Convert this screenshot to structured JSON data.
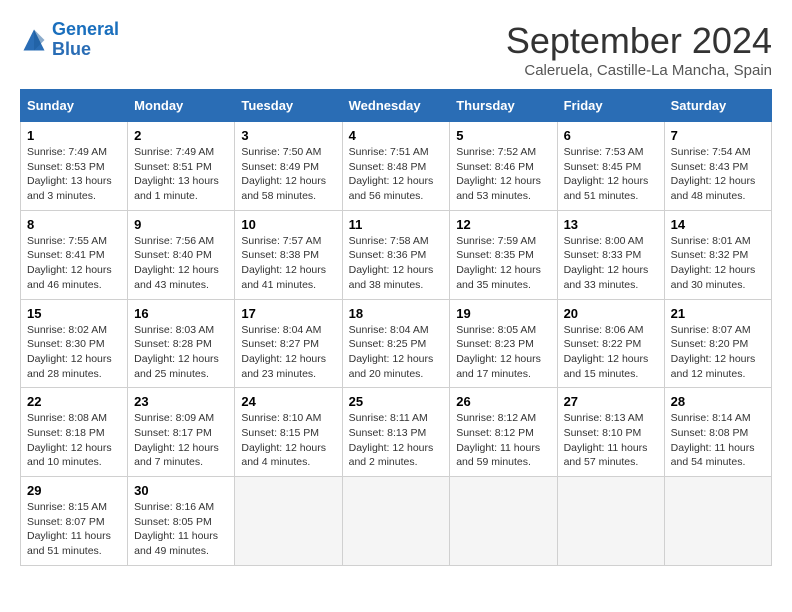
{
  "header": {
    "logo_line1": "General",
    "logo_line2": "Blue",
    "month_title": "September 2024",
    "location": "Caleruela, Castille-La Mancha, Spain"
  },
  "weekdays": [
    "Sunday",
    "Monday",
    "Tuesday",
    "Wednesday",
    "Thursday",
    "Friday",
    "Saturday"
  ],
  "weeks": [
    [
      {
        "day": "1",
        "sunrise": "7:49 AM",
        "sunset": "8:53 PM",
        "daylight": "13 hours and 3 minutes."
      },
      {
        "day": "2",
        "sunrise": "7:49 AM",
        "sunset": "8:51 PM",
        "daylight": "13 hours and 1 minute."
      },
      {
        "day": "3",
        "sunrise": "7:50 AM",
        "sunset": "8:49 PM",
        "daylight": "12 hours and 58 minutes."
      },
      {
        "day": "4",
        "sunrise": "7:51 AM",
        "sunset": "8:48 PM",
        "daylight": "12 hours and 56 minutes."
      },
      {
        "day": "5",
        "sunrise": "7:52 AM",
        "sunset": "8:46 PM",
        "daylight": "12 hours and 53 minutes."
      },
      {
        "day": "6",
        "sunrise": "7:53 AM",
        "sunset": "8:45 PM",
        "daylight": "12 hours and 51 minutes."
      },
      {
        "day": "7",
        "sunrise": "7:54 AM",
        "sunset": "8:43 PM",
        "daylight": "12 hours and 48 minutes."
      }
    ],
    [
      {
        "day": "8",
        "sunrise": "7:55 AM",
        "sunset": "8:41 PM",
        "daylight": "12 hours and 46 minutes."
      },
      {
        "day": "9",
        "sunrise": "7:56 AM",
        "sunset": "8:40 PM",
        "daylight": "12 hours and 43 minutes."
      },
      {
        "day": "10",
        "sunrise": "7:57 AM",
        "sunset": "8:38 PM",
        "daylight": "12 hours and 41 minutes."
      },
      {
        "day": "11",
        "sunrise": "7:58 AM",
        "sunset": "8:36 PM",
        "daylight": "12 hours and 38 minutes."
      },
      {
        "day": "12",
        "sunrise": "7:59 AM",
        "sunset": "8:35 PM",
        "daylight": "12 hours and 35 minutes."
      },
      {
        "day": "13",
        "sunrise": "8:00 AM",
        "sunset": "8:33 PM",
        "daylight": "12 hours and 33 minutes."
      },
      {
        "day": "14",
        "sunrise": "8:01 AM",
        "sunset": "8:32 PM",
        "daylight": "12 hours and 30 minutes."
      }
    ],
    [
      {
        "day": "15",
        "sunrise": "8:02 AM",
        "sunset": "8:30 PM",
        "daylight": "12 hours and 28 minutes."
      },
      {
        "day": "16",
        "sunrise": "8:03 AM",
        "sunset": "8:28 PM",
        "daylight": "12 hours and 25 minutes."
      },
      {
        "day": "17",
        "sunrise": "8:04 AM",
        "sunset": "8:27 PM",
        "daylight": "12 hours and 23 minutes."
      },
      {
        "day": "18",
        "sunrise": "8:04 AM",
        "sunset": "8:25 PM",
        "daylight": "12 hours and 20 minutes."
      },
      {
        "day": "19",
        "sunrise": "8:05 AM",
        "sunset": "8:23 PM",
        "daylight": "12 hours and 17 minutes."
      },
      {
        "day": "20",
        "sunrise": "8:06 AM",
        "sunset": "8:22 PM",
        "daylight": "12 hours and 15 minutes."
      },
      {
        "day": "21",
        "sunrise": "8:07 AM",
        "sunset": "8:20 PM",
        "daylight": "12 hours and 12 minutes."
      }
    ],
    [
      {
        "day": "22",
        "sunrise": "8:08 AM",
        "sunset": "8:18 PM",
        "daylight": "12 hours and 10 minutes."
      },
      {
        "day": "23",
        "sunrise": "8:09 AM",
        "sunset": "8:17 PM",
        "daylight": "12 hours and 7 minutes."
      },
      {
        "day": "24",
        "sunrise": "8:10 AM",
        "sunset": "8:15 PM",
        "daylight": "12 hours and 4 minutes."
      },
      {
        "day": "25",
        "sunrise": "8:11 AM",
        "sunset": "8:13 PM",
        "daylight": "12 hours and 2 minutes."
      },
      {
        "day": "26",
        "sunrise": "8:12 AM",
        "sunset": "8:12 PM",
        "daylight": "11 hours and 59 minutes."
      },
      {
        "day": "27",
        "sunrise": "8:13 AM",
        "sunset": "8:10 PM",
        "daylight": "11 hours and 57 minutes."
      },
      {
        "day": "28",
        "sunrise": "8:14 AM",
        "sunset": "8:08 PM",
        "daylight": "11 hours and 54 minutes."
      }
    ],
    [
      {
        "day": "29",
        "sunrise": "8:15 AM",
        "sunset": "8:07 PM",
        "daylight": "11 hours and 51 minutes."
      },
      {
        "day": "30",
        "sunrise": "8:16 AM",
        "sunset": "8:05 PM",
        "daylight": "11 hours and 49 minutes."
      },
      null,
      null,
      null,
      null,
      null
    ]
  ]
}
